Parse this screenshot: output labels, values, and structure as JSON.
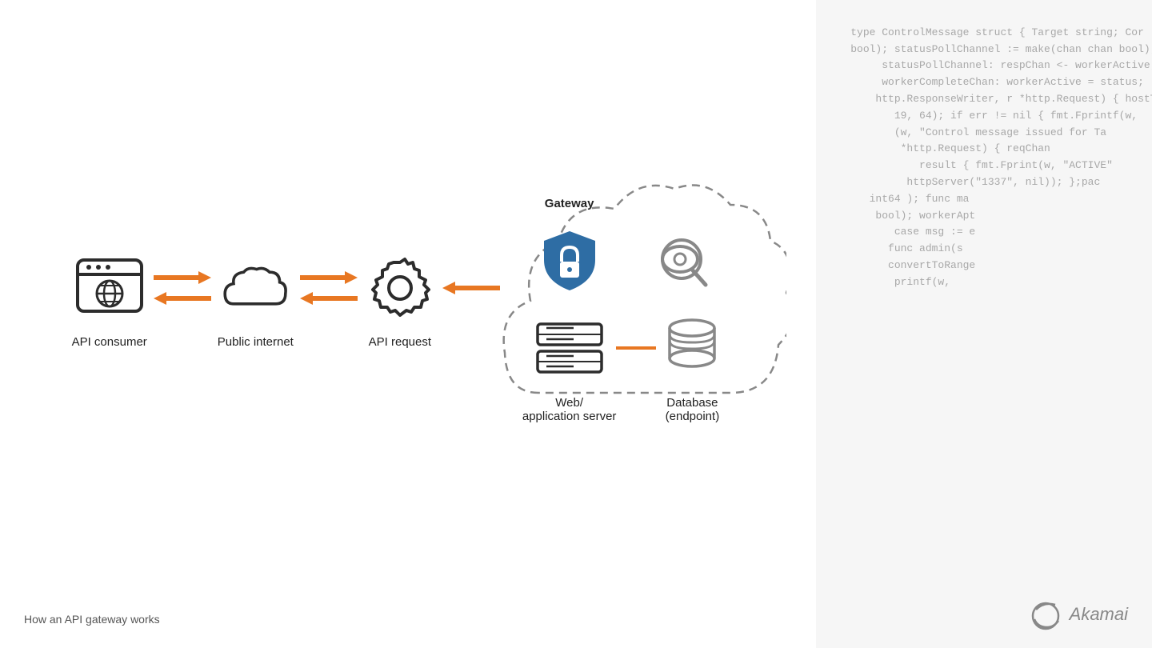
{
  "code_lines": [
    "  type ControlMessage struct { Target string; Cor",
    "  bool); statusPollChannel := make(chan chan bool); v",
    "       statusPollChannel: respChan <- workerActive; case",
    "       workerCompleteChan: workerActive = status;",
    "      http.ResponseWriter, r *http.Request) { hostTo",
    "         19, 64); if err != nil { fmt.Fprintf(w,",
    "         (w, \"Control message issued for Ta",
    "          *http.Request) { reqChan",
    "             result { fmt.Fprint(w, \"ACTIVE\"",
    "           httpServer(\"1337\", nil)); };pac",
    "     int64 ); func ma",
    "      bool); workerApt",
    "         case msg := e",
    "        func admin(s",
    "        convertToRange",
    "         printf(w,",
    ""
  ],
  "nodes": {
    "api_consumer": {
      "label": "API consumer"
    },
    "public_internet": {
      "label": "Public internet"
    },
    "api_request": {
      "label": "API request"
    },
    "gateway": {
      "label": "Gateway"
    },
    "web_server": {
      "label": "Web/\napplication server"
    },
    "database": {
      "label": "Database\n(endpoint)"
    }
  },
  "caption": "How an API gateway works",
  "akamai": "Akamai",
  "colors": {
    "orange": "#E87722",
    "dark_icon": "#2c2c2c",
    "blue_shield": "#2E6DA4",
    "gray_icon": "#888888"
  }
}
